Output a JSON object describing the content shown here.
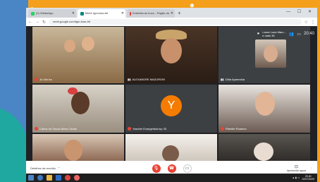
{
  "browser": {
    "tabs": [
      {
        "label": "(2) WhatsApp",
        "color": "#25d366",
        "active": false
      },
      {
        "label": "Meet: tgm-fzao-bit",
        "color": "#00897b",
        "active": true
      },
      {
        "label": "Endireita as truco - Pagão da",
        "color": "#e53935",
        "active": false
      }
    ],
    "url": "meet.google.com/tgm-fzao-bit"
  },
  "meet": {
    "top_info_name": "Laura Luna Marc...",
    "top_info_more": "e mais 35",
    "clock": "20:40"
  },
  "participants": [
    {
      "name": "Ju Ulis ba",
      "muted": true
    },
    {
      "name": "ALEXANDRE MAZUROW",
      "muted": false
    },
    {
      "name": "Zilda Aparecida",
      "muted": false
    },
    {
      "name": "Carlos de Souza Alves Carlos",
      "muted": true
    },
    {
      "name": "Yasmim Evangelista top 33",
      "muted": true,
      "initial": "Y"
    },
    {
      "name": "Ribeitte Rolamor",
      "muted": true
    },
    {
      "name": "",
      "muted": false
    },
    {
      "name": "",
      "muted": false
    },
    {
      "name": "",
      "muted": false
    }
  ],
  "bottom": {
    "details_label": "Detalhes da reunião",
    "present_label": "Apresentar agora"
  },
  "taskbar": {
    "time": "20:40",
    "date": "22/07/2020"
  },
  "colors": {
    "hangup": "#ea4335",
    "avatar": "#f57c00",
    "bg_orange": "#f4a01c",
    "bg_blue": "#4a86c6"
  }
}
